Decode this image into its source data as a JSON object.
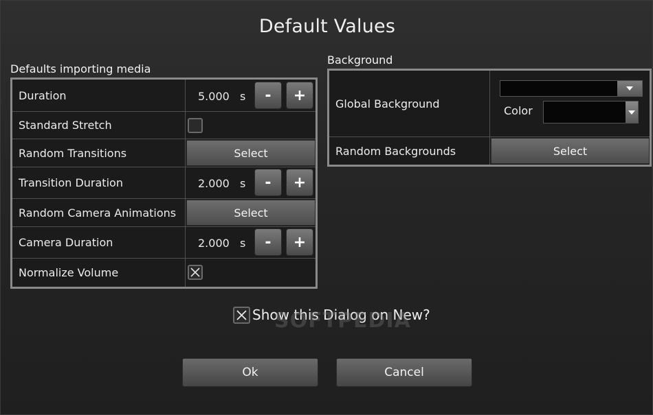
{
  "dialog": {
    "title": "Default Values",
    "watermark": "SOFTPEDIA"
  },
  "defaults_import": {
    "group_label": "Defaults importing media",
    "rows": [
      {
        "label": "Duration",
        "value": "5.000",
        "unit": "s",
        "minus": "-",
        "plus": "+"
      },
      {
        "label": "Standard Stretch",
        "checked": false
      },
      {
        "label": "Random Transitions",
        "button": "Select"
      },
      {
        "label": "Transition Duration",
        "value": "2.000",
        "unit": "s",
        "minus": "-",
        "plus": "+"
      },
      {
        "label": "Random Camera Animations",
        "button": "Select"
      },
      {
        "label": "Camera Duration",
        "value": "2.000",
        "unit": "s",
        "minus": "-",
        "plus": "+"
      },
      {
        "label": "Normalize Volume",
        "checked": true
      }
    ]
  },
  "background": {
    "group_label": "Background",
    "global_label": "Global Background",
    "color_label": "Color",
    "random_label": "Random Backgrounds",
    "random_button": "Select"
  },
  "footer": {
    "show_dialog_label": "Show this Dialog on New?",
    "show_dialog_checked": true,
    "ok_label": "Ok",
    "cancel_label": "Cancel"
  },
  "colors": {
    "panel_border": "#8a8a8a",
    "background_color_value": "#000000"
  }
}
